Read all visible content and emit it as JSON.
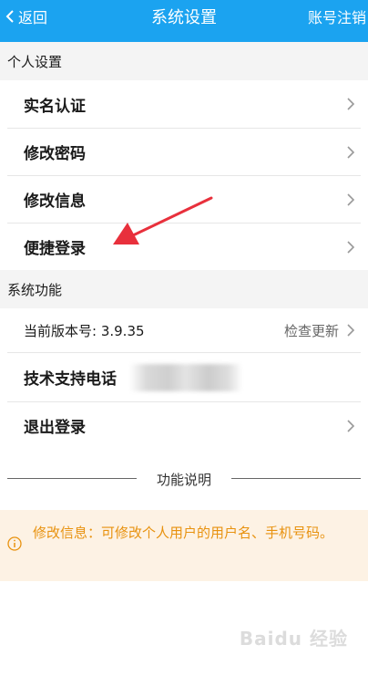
{
  "header": {
    "back_label": "返回",
    "title": "系统设置",
    "logout_label": "账号注销"
  },
  "personal_section": {
    "title": "个人设置",
    "items": [
      {
        "label": "实名认证"
      },
      {
        "label": "修改密码"
      },
      {
        "label": "修改信息"
      },
      {
        "label": "便捷登录"
      }
    ]
  },
  "system_section": {
    "title": "系统功能",
    "version_label": "当前版本号: 3.9.35",
    "check_update_label": "检查更新",
    "support_label": "技术支持电话",
    "logout_label": "退出登录"
  },
  "function_description": {
    "title": "功能说明",
    "notice_text": "修改信息：可修改个人用户的用户名、手机号码。"
  },
  "watermark": "Baidu 经验",
  "colors": {
    "header_bg": "#1ba3f0",
    "section_bg": "#f4f4f4",
    "notice_bg": "#fdf2e4",
    "notice_text": "#e8920f",
    "arrow": "#e8303c"
  }
}
